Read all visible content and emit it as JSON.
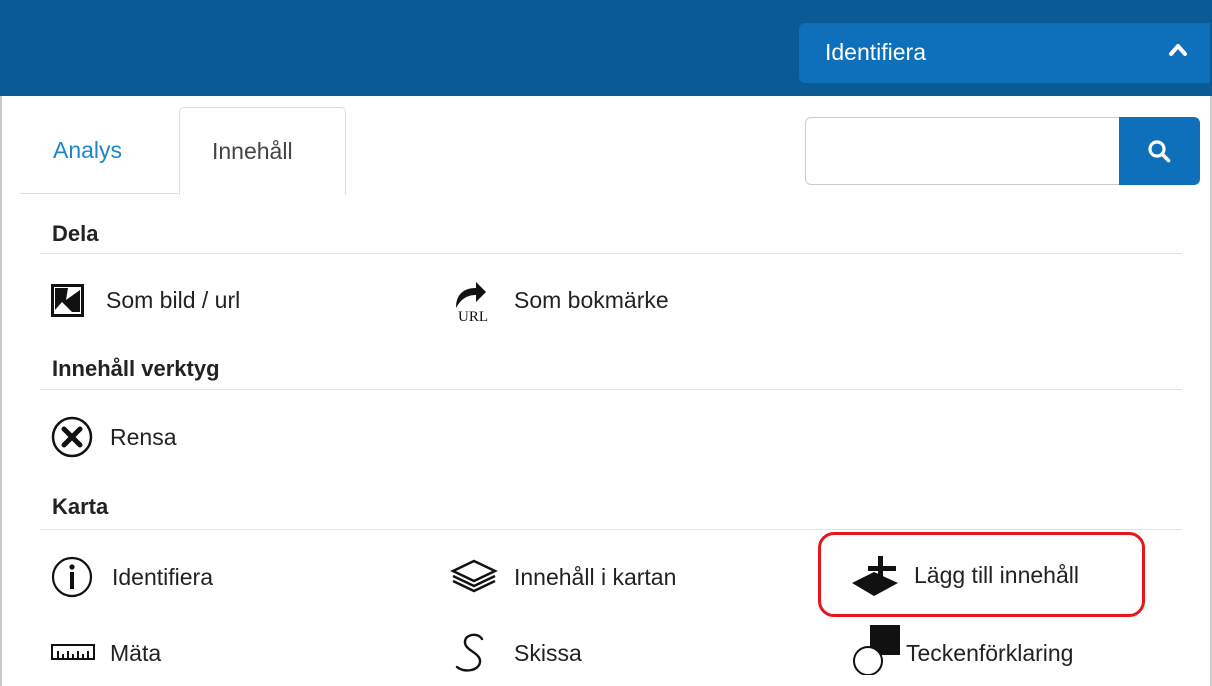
{
  "header": {
    "identify_label": "Identifiera",
    "identify_icon": "chevron-up-icon",
    "bar_color": "#0a5a96",
    "button_color": "#0e6fbb"
  },
  "tabs": [
    {
      "label": "Analys",
      "active": false
    },
    {
      "label": "Innehåll",
      "active": true
    }
  ],
  "search": {
    "value": "",
    "placeholder": "",
    "icon": "search-icon"
  },
  "sections": {
    "dela": {
      "title": "Dela",
      "items": [
        {
          "label": "Som bild / url",
          "icon": "image-url-icon"
        },
        {
          "label": "Som bokmärke",
          "icon": "bookmark-url-icon",
          "icon_text": "URL"
        }
      ]
    },
    "verktyg": {
      "title": "Innehåll verktyg",
      "items": [
        {
          "label": "Rensa",
          "icon": "clear-x-icon"
        }
      ]
    },
    "karta": {
      "title": "Karta",
      "items": [
        {
          "label": "Identifiera",
          "icon": "info-icon"
        },
        {
          "label": "Innehåll i kartan",
          "icon": "layers-icon"
        },
        {
          "label": "Lägg till innehåll",
          "icon": "add-layer-icon"
        },
        {
          "label": "Mäta",
          "icon": "ruler-icon"
        },
        {
          "label": "Skissa",
          "icon": "sketch-icon"
        },
        {
          "label": "Teckenförklaring",
          "icon": "legend-icon"
        }
      ]
    }
  },
  "highlight_color": "#e8161c"
}
